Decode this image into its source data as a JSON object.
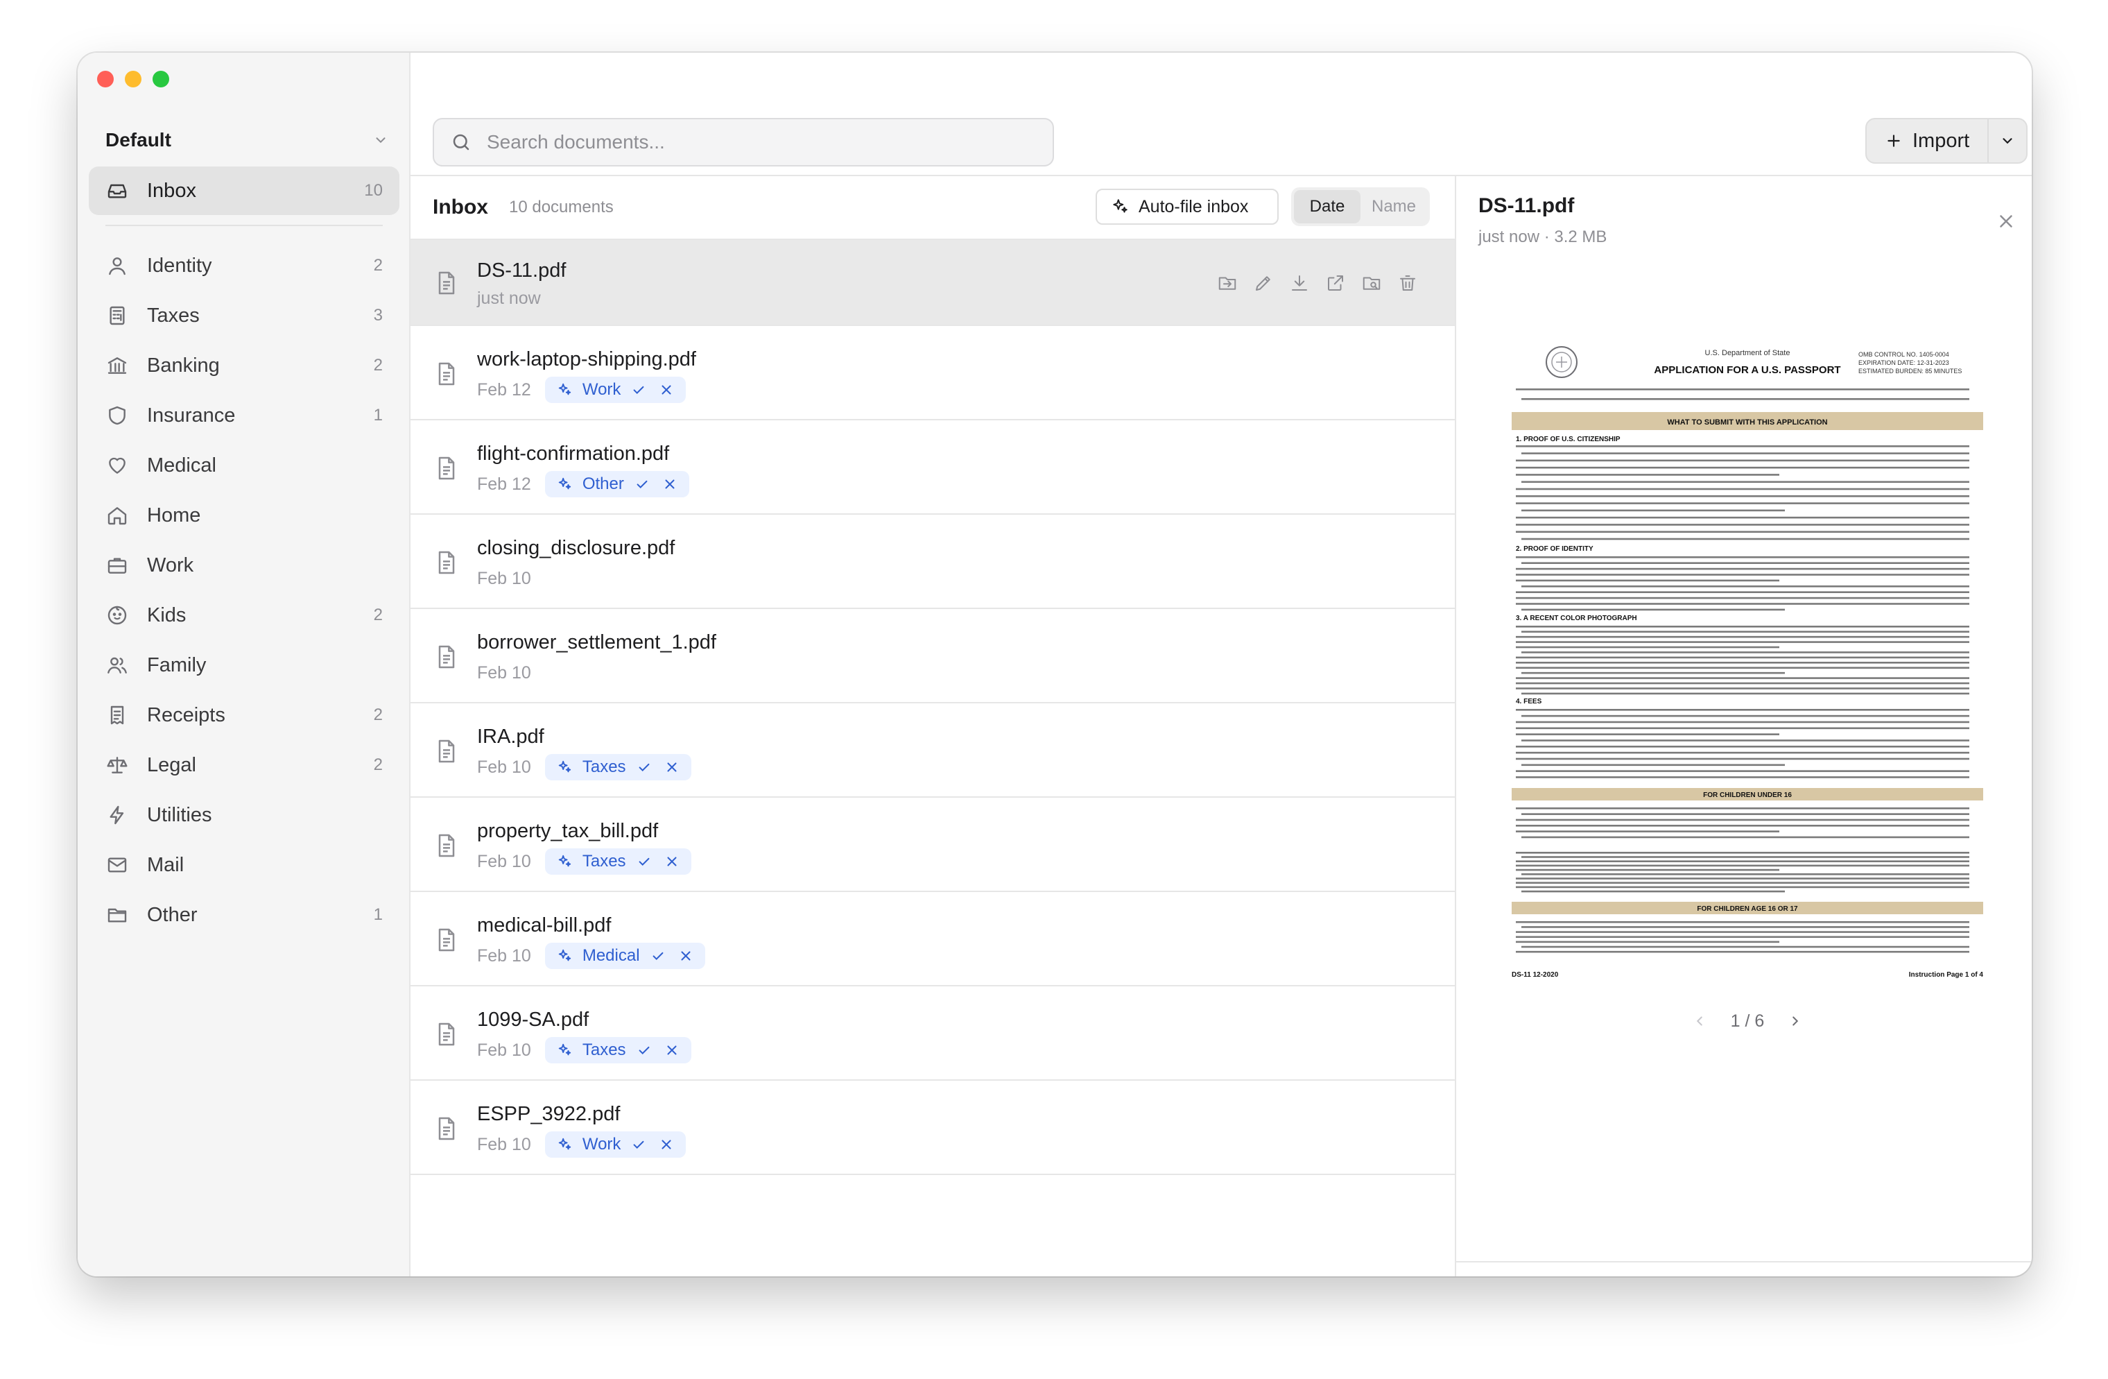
{
  "sidebar": {
    "workspace": "Default",
    "inbox": {
      "label": "Inbox",
      "count": "10"
    },
    "items": [
      {
        "label": "Identity",
        "count": "2",
        "icon": "person-icon"
      },
      {
        "label": "Taxes",
        "count": "3",
        "icon": "calculator-icon"
      },
      {
        "label": "Banking",
        "count": "2",
        "icon": "bank-icon"
      },
      {
        "label": "Insurance",
        "count": "1",
        "icon": "shield-icon"
      },
      {
        "label": "Medical",
        "count": "",
        "icon": "heart-icon"
      },
      {
        "label": "Home",
        "count": "",
        "icon": "house-icon"
      },
      {
        "label": "Work",
        "count": "",
        "icon": "briefcase-icon"
      },
      {
        "label": "Kids",
        "count": "2",
        "icon": "baby-icon"
      },
      {
        "label": "Family",
        "count": "",
        "icon": "people-icon"
      },
      {
        "label": "Receipts",
        "count": "2",
        "icon": "receipt-icon"
      },
      {
        "label": "Legal",
        "count": "2",
        "icon": "scales-icon"
      },
      {
        "label": "Utilities",
        "count": "",
        "icon": "bolt-icon"
      },
      {
        "label": "Mail",
        "count": "",
        "icon": "mail-icon"
      },
      {
        "label": "Other",
        "count": "1",
        "icon": "folder-icon"
      }
    ]
  },
  "toolbar": {
    "search_placeholder": "Search documents...",
    "import_label": "Import"
  },
  "list": {
    "title": "Inbox",
    "count_label": "10 documents",
    "autofile_label": "Auto-file inbox",
    "sort_date": "Date",
    "sort_name": "Name",
    "rows": [
      {
        "name": "DS-11.pdf",
        "date": "just now",
        "tag": ""
      },
      {
        "name": "work-laptop-shipping.pdf",
        "date": "Feb 12",
        "tag": "Work"
      },
      {
        "name": "flight-confirmation.pdf",
        "date": "Feb 12",
        "tag": "Other"
      },
      {
        "name": "closing_disclosure.pdf",
        "date": "Feb 10",
        "tag": ""
      },
      {
        "name": "borrower_settlement_1.pdf",
        "date": "Feb 10",
        "tag": ""
      },
      {
        "name": "IRA.pdf",
        "date": "Feb 10",
        "tag": "Taxes"
      },
      {
        "name": "property_tax_bill.pdf",
        "date": "Feb 10",
        "tag": "Taxes"
      },
      {
        "name": "medical-bill.pdf",
        "date": "Feb 10",
        "tag": "Medical"
      },
      {
        "name": "1099-SA.pdf",
        "date": "Feb 10",
        "tag": "Taxes"
      },
      {
        "name": "ESPP_3922.pdf",
        "date": "Feb 10",
        "tag": "Work"
      }
    ]
  },
  "preview": {
    "title": "DS-11.pdf",
    "meta": "just now · 3.2 MB",
    "page_indicator": "1 / 6",
    "doc": {
      "agency": "U.S. Department of State",
      "heading": "APPLICATION FOR A U.S. PASSPORT",
      "omb": "OMB CONTROL NO. 1405-0004",
      "expiration": "EXPIRATION DATE: 12-31-2023",
      "burden": "ESTIMATED BURDEN: 85 MINUTES",
      "bar1": "WHAT TO SUBMIT WITH THIS APPLICATION",
      "s1": "1. PROOF OF U.S. CITIZENSHIP",
      "s2": "2. PROOF OF IDENTITY",
      "s3": "3. A RECENT COLOR PHOTOGRAPH",
      "s4": "4. FEES",
      "bar2": "FOR CHILDREN UNDER 16",
      "bar3": "FOR CHILDREN AGE 16 OR 17",
      "footer_left": "DS-11   12-2020",
      "footer_right": "Instruction Page 1 of 4"
    }
  },
  "colors": {
    "accent": "#2f5fd0",
    "tag_bg": "#eaf1ff",
    "doc_bar": "#d8c7a4"
  }
}
